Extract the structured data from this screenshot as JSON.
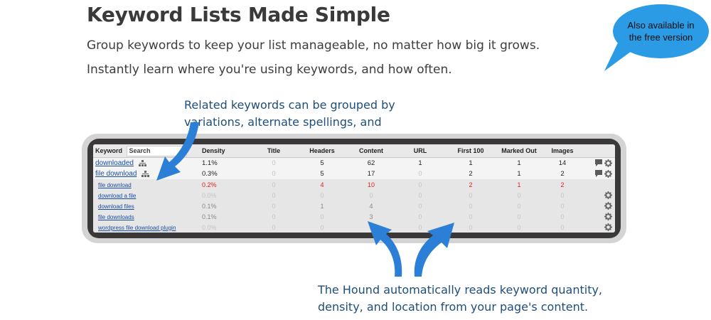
{
  "header": {
    "title": "Keyword Lists Made Simple",
    "lead_1": "Group keywords to keep your list manageable, no matter how big it grows.",
    "lead_2": "Instantly learn where you're using keywords, and how often."
  },
  "badge": {
    "text": "Also available in the free version"
  },
  "callouts": {
    "top": "Related keywords can be grouped by variations, alternate spellings, and plurals.",
    "bottom": "The Hound automatically reads keyword quantity, density, and location from your page's content."
  },
  "table": {
    "columns": [
      "Keyword",
      "Density",
      "Title",
      "Headers",
      "Content",
      "URL",
      "First 100",
      "Marked Out",
      "Images"
    ],
    "search_placeholder": "Search",
    "rows": [
      {
        "keyword": "downloaded",
        "density": "1.1%",
        "title": "0",
        "headers": "5",
        "content": "62",
        "url": "1",
        "first100": "1",
        "marked": "1",
        "images": "14"
      },
      {
        "keyword": "file download",
        "density": "0.3%",
        "title": "0",
        "headers": "5",
        "content": "17",
        "url": "0",
        "first100": "2",
        "marked": "1",
        "images": "2"
      },
      {
        "keyword": "file download",
        "density": "0.2%",
        "title": "0",
        "headers": "4",
        "content": "10",
        "url": "0",
        "first100": "2",
        "marked": "1",
        "images": "2"
      },
      {
        "keyword": "download a file",
        "density": "0.0%",
        "title": "0",
        "headers": "0",
        "content": "0",
        "url": "0",
        "first100": "0",
        "marked": "0",
        "images": "0"
      },
      {
        "keyword": "download files",
        "density": "0.1%",
        "title": "0",
        "headers": "1",
        "content": "4",
        "url": "0",
        "first100": "0",
        "marked": "0",
        "images": "0"
      },
      {
        "keyword": "file downloads",
        "density": "0.1%",
        "title": "0",
        "headers": "0",
        "content": "3",
        "url": "0",
        "first100": "0",
        "marked": "0",
        "images": "0"
      },
      {
        "keyword": "wordpress file download plugin",
        "density": "0.0%",
        "title": "0",
        "headers": "0",
        "content": "0",
        "url": "0",
        "first100": "0",
        "marked": "0",
        "images": "0"
      }
    ]
  },
  "colors": {
    "accent_blue": "#2c7fd6",
    "badge_blue": "#2c9be6",
    "callout_text": "#1f4e79",
    "highlight_red": "#e0201a"
  }
}
